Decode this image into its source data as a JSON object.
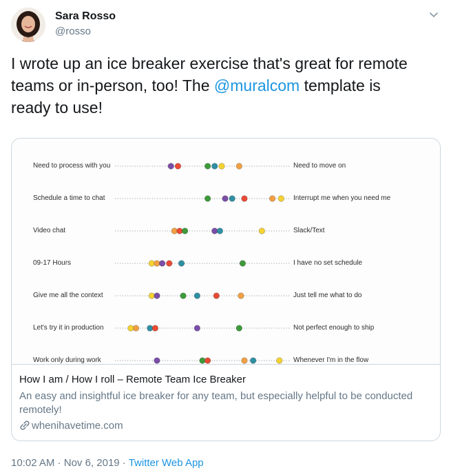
{
  "user": {
    "name": "Sara Rosso",
    "handle": "@rosso"
  },
  "tweet": {
    "text_line1": "I wrote up an ice breaker exercise that's great for remote",
    "text_line2_pre": "teams or in-person, too! The ",
    "mention": "@muralcom",
    "text_line2_post": " template is",
    "text_line3": "ready to use!"
  },
  "card": {
    "rows": [
      {
        "left": "Need to process with you",
        "right": "Need to move on",
        "dots": [
          [
            "purple",
            0.32
          ],
          [
            "red",
            0.36
          ],
          [
            "green",
            0.53
          ],
          [
            "teal",
            0.57
          ],
          [
            "yellow",
            0.61
          ],
          [
            "orange",
            0.71
          ]
        ]
      },
      {
        "left": "Schedule a time to chat",
        "right": "Interrupt me when you need me",
        "dots": [
          [
            "green",
            0.53
          ],
          [
            "purple",
            0.63
          ],
          [
            "teal",
            0.67
          ],
          [
            "red",
            0.74
          ],
          [
            "orange",
            0.9
          ],
          [
            "yellow",
            0.95
          ]
        ]
      },
      {
        "left": "Video chat",
        "right": "Slack/Text",
        "dots": [
          [
            "orange",
            0.34
          ],
          [
            "red",
            0.37
          ],
          [
            "green",
            0.4
          ],
          [
            "purple",
            0.57
          ],
          [
            "teal",
            0.6
          ],
          [
            "yellow",
            0.84
          ]
        ]
      },
      {
        "left": "09-17 Hours",
        "right": "I have no set schedule",
        "dots": [
          [
            "yellow",
            0.21
          ],
          [
            "orange",
            0.24
          ],
          [
            "purple",
            0.27
          ],
          [
            "red",
            0.31
          ],
          [
            "teal",
            0.38
          ],
          [
            "green",
            0.73
          ]
        ]
      },
      {
        "left": "Give me all the context",
        "right": "Just tell me what to do",
        "dots": [
          [
            "yellow",
            0.21
          ],
          [
            "purple",
            0.24
          ],
          [
            "green",
            0.39
          ],
          [
            "teal",
            0.47
          ],
          [
            "red",
            0.58
          ],
          [
            "orange",
            0.72
          ]
        ]
      },
      {
        "left": "Let's try it in production",
        "right": "Not perfect enough to ship",
        "dots": [
          [
            "yellow",
            0.09
          ],
          [
            "orange",
            0.12
          ],
          [
            "teal",
            0.2
          ],
          [
            "red",
            0.23
          ],
          [
            "purple",
            0.47
          ],
          [
            "green",
            0.71
          ]
        ]
      },
      {
        "left": "Work only during work",
        "right": "Whenever I'm in the flow",
        "dots": [
          [
            "purple",
            0.24
          ],
          [
            "green",
            0.5
          ],
          [
            "red",
            0.53
          ],
          [
            "orange",
            0.74
          ],
          [
            "teal",
            0.79
          ],
          [
            "yellow",
            0.94
          ]
        ]
      }
    ],
    "title": "How I am / How I roll – Remote Team Ice Breaker",
    "description": "An easy and insightful ice breaker for any team, but especially helpful to be conducted remotely!",
    "domain": "whenihavetime.com",
    "link_icon": "link-icon"
  },
  "meta": {
    "time": "10:02 AM",
    "separator1": " · ",
    "date": "Nov 6, 2019",
    "separator2": " · ",
    "app": "Twitter Web App"
  },
  "colors": {
    "purple": "#7b4ea8",
    "red": "#e94b35",
    "green": "#3e9a3a",
    "teal": "#2f8fa3",
    "yellow": "#f5d233",
    "orange": "#f1a043",
    "accent": "#1b95e0"
  }
}
